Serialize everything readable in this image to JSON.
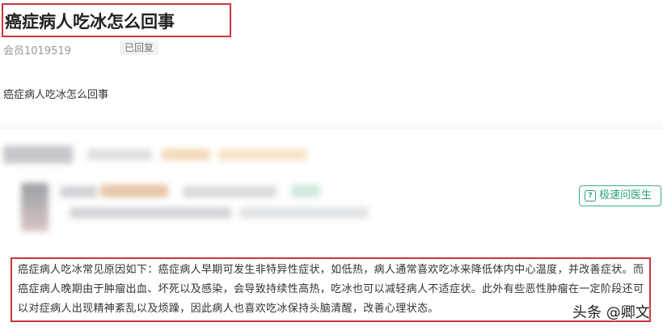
{
  "question": {
    "title": "癌症病人吃冰怎么回事",
    "member": "会员1019519",
    "status_badge": "已回复",
    "body": "癌症病人吃冰怎么回事"
  },
  "doctor": {
    "ask_button_label": "极速问医生",
    "ask_icon": "chat-question-icon"
  },
  "answer": {
    "text": "癌症病人吃冰常见原因如下：癌症病人早期可发生非特异性症状，如低热，病人通常喜欢吃冰来降低体内中心温度，并改善症状。而癌症病人晚期由于肿瘤出血、坏死以及感染，会导致持续性高热，吃冰也可以减轻病人不适症状。此外有些恶性肿瘤在一定阶段还可以对症病人出现精神紊乱以及烦躁，因此病人也喜欢吃冰保持头脑清醒，改善心理状态。"
  },
  "watermark": "头条 @卿文",
  "colors": {
    "highlight_border": "#c9363d",
    "ask_button": "#2a9d78"
  }
}
